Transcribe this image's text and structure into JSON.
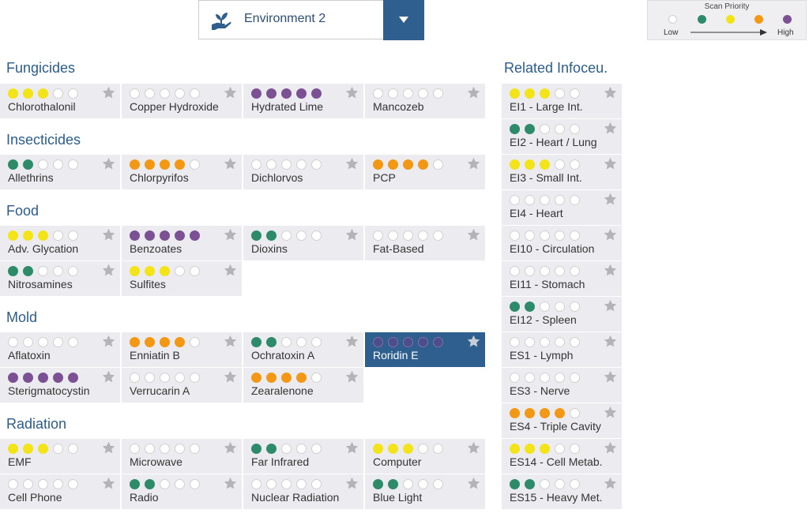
{
  "environment": {
    "label": "Environment 2"
  },
  "legend": {
    "title": "Scan Priority",
    "low": "Low",
    "high": "High",
    "colors": [
      "#ffffff",
      "#2e8b6a",
      "#f3e419",
      "#f39814",
      "#7b5194"
    ]
  },
  "sections": [
    {
      "title": "Fungicides",
      "items": [
        {
          "label": "Chlorothalonil",
          "level": 2,
          "count": 3
        },
        {
          "label": "Copper Hydroxide",
          "level": 0,
          "count": 0
        },
        {
          "label": "Hydrated Lime",
          "level": 4,
          "count": 5
        },
        {
          "label": "Mancozeb",
          "level": 0,
          "count": 0
        }
      ]
    },
    {
      "title": "Insecticides",
      "items": [
        {
          "label": "Allethrins",
          "level": 1,
          "count": 2
        },
        {
          "label": "Chlorpyrifos",
          "level": 3,
          "count": 4
        },
        {
          "label": "Dichlorvos",
          "level": 0,
          "count": 0
        },
        {
          "label": "PCP",
          "level": 3,
          "count": 4
        }
      ]
    },
    {
      "title": "Food",
      "items": [
        {
          "label": "Adv. Glycation",
          "level": 2,
          "count": 3
        },
        {
          "label": "Benzoates",
          "level": 4,
          "count": 5
        },
        {
          "label": "Dioxins",
          "level": 1,
          "count": 2
        },
        {
          "label": "Fat-Based",
          "level": 0,
          "count": 0
        },
        {
          "label": "Nitrosamines",
          "level": 1,
          "count": 2
        },
        {
          "label": "Sulfites",
          "level": 2,
          "count": 3
        }
      ]
    },
    {
      "title": "Mold",
      "items": [
        {
          "label": "Aflatoxin",
          "level": 0,
          "count": 0
        },
        {
          "label": "Enniatin B",
          "level": 3,
          "count": 4
        },
        {
          "label": "Ochratoxin A",
          "level": 1,
          "count": 2
        },
        {
          "label": "Roridin E",
          "level": 4,
          "count": 5,
          "selected": true
        },
        {
          "label": "Sterigmatocystin",
          "level": 4,
          "count": 5
        },
        {
          "label": "Verrucarin A",
          "level": 0,
          "count": 0
        },
        {
          "label": "Zearalenone",
          "level": 3,
          "count": 4
        }
      ]
    },
    {
      "title": "Radiation",
      "items": [
        {
          "label": "EMF",
          "level": 2,
          "count": 3
        },
        {
          "label": "Microwave",
          "level": 0,
          "count": 0
        },
        {
          "label": "Far Infrared",
          "level": 1,
          "count": 2
        },
        {
          "label": "Computer",
          "level": 2,
          "count": 3
        },
        {
          "label": "Cell Phone",
          "level": 0,
          "count": 0
        },
        {
          "label": "Radio",
          "level": 1,
          "count": 2
        },
        {
          "label": "Nuclear Radiation",
          "level": 0,
          "count": 0
        },
        {
          "label": "Blue Light",
          "level": 1,
          "count": 2
        }
      ]
    }
  ],
  "related": {
    "title": "Related Infoceu.",
    "items": [
      {
        "label": "EI1 - Large Int.",
        "level": 2,
        "count": 3
      },
      {
        "label": "EI2 - Heart / Lung",
        "level": 1,
        "count": 2
      },
      {
        "label": "EI3 - Small Int.",
        "level": 2,
        "count": 3
      },
      {
        "label": "EI4 - Heart",
        "level": 0,
        "count": 0
      },
      {
        "label": "EI10 - Circulation",
        "level": 0,
        "count": 0
      },
      {
        "label": "EI11 - Stomach",
        "level": 0,
        "count": 0
      },
      {
        "label": "EI12 - Spleen",
        "level": 1,
        "count": 2
      },
      {
        "label": "ES1 - Lymph",
        "level": 0,
        "count": 0
      },
      {
        "label": "ES3 - Nerve",
        "level": 0,
        "count": 0
      },
      {
        "label": "ES4 - Triple Cavity",
        "level": 3,
        "count": 4
      },
      {
        "label": "ES14 - Cell Metab.",
        "level": 2,
        "count": 3
      },
      {
        "label": "ES15 - Heavy Met.",
        "level": 1,
        "count": 2
      }
    ]
  }
}
